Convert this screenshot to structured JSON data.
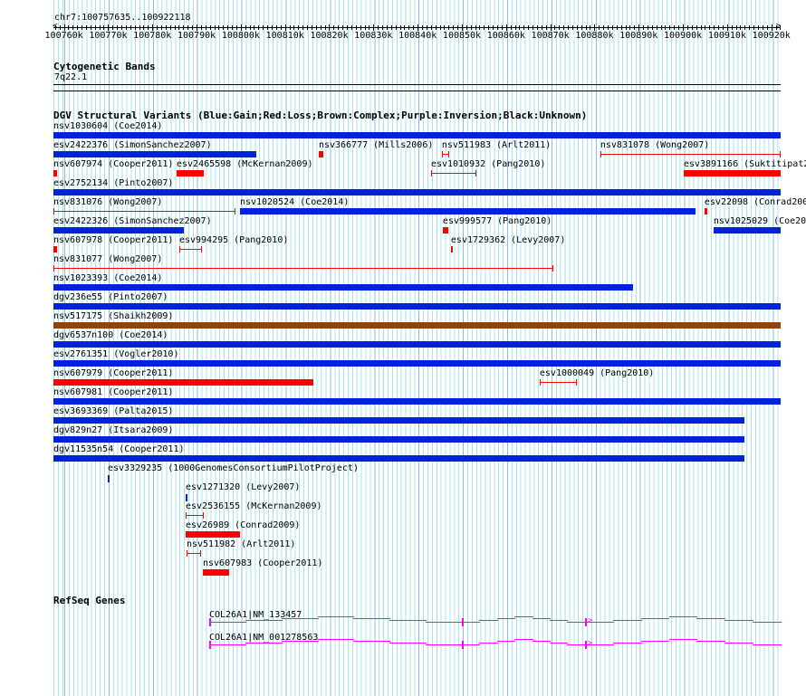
{
  "ruler": {
    "location": "chr7:100757635..100922118",
    "view_start": 100757635,
    "view_end": 100922118,
    "ticks": [
      "100760k",
      "100770k",
      "100780k",
      "100790k",
      "100800k",
      "100810k",
      "100820k",
      "100830k",
      "100840k",
      "100850k",
      "100860k",
      "100870k",
      "100880k",
      "100890k",
      "100900k",
      "100910k",
      "100920k"
    ]
  },
  "cyto": {
    "title": "Cytogenetic Bands",
    "band": "7q22.1"
  },
  "dgv": {
    "title": "DGV Structural Variants (Blue:Gain;Red:Loss;Brown:Complex;Purple:Inversion;Black:Unknown)",
    "colors": {
      "gain": "#0022dd",
      "loss": "#ff0000",
      "complex": "#8b4513"
    },
    "rows": [
      [
        {
          "label": "nsv1030604 (Coe2014)",
          "s": 100757635,
          "e": 100922118,
          "t": "gain"
        }
      ],
      [
        {
          "label": "esv2422376 (SimonSanchez2007)",
          "s": 100757635,
          "e": 100803510,
          "t": "gain"
        },
        {
          "label": "nsv366777 (Mills2006)",
          "s": 100817640,
          "e": 100818670,
          "t": "loss"
        },
        {
          "label": "nsv511983 (Arlt2011)",
          "s": 100845490,
          "e": 100847130,
          "t": "loss",
          "thin": true
        },
        {
          "label": "nsv831078 (Wong2007)",
          "s": 100881330,
          "e": 100922118,
          "t": "loss",
          "thin": true
        }
      ],
      [
        {
          "label": "nsv607974 (Cooper2011)",
          "s": 100757635,
          "e": 100758450,
          "t": "loss"
        },
        {
          "label": "esv2465598 (McKernan2009)",
          "s": 100785490,
          "e": 100791630,
          "t": "loss"
        },
        {
          "label": "esv1010932 (Pang2010)",
          "s": 100843040,
          "e": 100853280,
          "t": "loss",
          "thin": true
        },
        {
          "label": "esv3891166 (Suktitipat2014)",
          "s": 100900180,
          "e": 100922118,
          "t": "loss"
        }
      ],
      [
        {
          "label": "esv2752134 (Pinto2007)",
          "s": 100757635,
          "e": 100922118,
          "t": "gain"
        }
      ],
      [
        {
          "label": "nsv831076 (Wong2007)",
          "s": 100757635,
          "e": 100798800,
          "t": "loss",
          "thin": true
        },
        {
          "label": "nsv1020524 (Coe2014)",
          "s": 100799820,
          "e": 100902840,
          "t": "gain"
        },
        {
          "label": "esv22098 (Conrad2009)",
          "s": 100904890,
          "e": 100905500,
          "t": "loss"
        }
      ],
      [
        {
          "label": "esv2422326 (SimonSanchez2007)",
          "s": 100757635,
          "e": 100787130,
          "t": "gain"
        },
        {
          "label": "esv999577 (Pang2010)",
          "s": 100845700,
          "e": 100846930,
          "t": "loss"
        },
        {
          "label": "nsv1025029 (Coe2014)",
          "s": 100906930,
          "e": 100922118,
          "t": "gain"
        }
      ],
      [
        {
          "label": "nsv607978 (Cooper2011)",
          "s": 100757635,
          "e": 100758450,
          "t": "loss"
        },
        {
          "label": "esv994295 (Pang2010)",
          "s": 100786100,
          "e": 100791220,
          "t": "loss",
          "thin": true
        },
        {
          "label": "esv1729362 (Levy2007)",
          "s": 100847540,
          "e": 100847950,
          "t": "loss"
        }
      ],
      [
        {
          "label": "nsv831077 (Wong2007)",
          "s": 100757635,
          "e": 100870690,
          "t": "loss",
          "thin": true
        }
      ],
      [
        {
          "label": "nsv1023393 (Coe2014)",
          "s": 100757635,
          "e": 100888710,
          "t": "gain"
        }
      ],
      [
        {
          "label": "dgv236e55 (Pinto2007)",
          "s": 100757635,
          "e": 100922118,
          "t": "gain"
        }
      ],
      [
        {
          "label": "nsv517175 (Shaikh2009)",
          "s": 100757635,
          "e": 100922118,
          "t": "complex"
        }
      ],
      [
        {
          "label": "dgv6537n100 (Coe2014)",
          "s": 100757635,
          "e": 100922118,
          "t": "gain"
        }
      ],
      [
        {
          "label": "esv2761351 (Vogler2010)",
          "s": 100757635,
          "e": 100922118,
          "t": "gain"
        }
      ],
      [
        {
          "label": "nsv607979 (Cooper2011)",
          "s": 100757635,
          "e": 100816410,
          "t": "loss"
        },
        {
          "label": "esv1000049 (Pang2010)",
          "s": 100867610,
          "e": 100876010,
          "t": "loss",
          "thin": true
        }
      ],
      [
        {
          "label": "nsv607981 (Cooper2011)",
          "s": 100757635,
          "e": 100922118,
          "t": "gain"
        }
      ],
      [
        {
          "label": "esv3693369 (Palta2015)",
          "s": 100757635,
          "e": 100913900,
          "t": "gain"
        }
      ],
      [
        {
          "label": "dgv829n27 (Itsara2009)",
          "s": 100757635,
          "e": 100913900,
          "t": "gain"
        }
      ],
      [
        {
          "label": "dgv11535n54 (Cooper2011)",
          "s": 100757635,
          "e": 100913900,
          "t": "gain"
        }
      ],
      [
        {
          "label": "esv3329235 (1000GenomesConsortiumPilotProject)",
          "s": 100769920,
          "e": 100770330,
          "t": "gain",
          "narrow": true
        }
      ],
      [
        {
          "label": "esv1271320 (Levy2007)",
          "s": 100787540,
          "e": 100787950,
          "t": "gain",
          "narrow": true
        }
      ],
      [
        {
          "label": "esv2536155 (McKernan2009)",
          "s": 100787540,
          "e": 100791630,
          "t": "loss",
          "thin": true
        }
      ],
      [
        {
          "label": "esv26989 (Conrad2009)",
          "s": 100787540,
          "e": 100799820,
          "t": "loss"
        }
      ],
      [
        {
          "label": "nsv511982 (Arlt2011)",
          "s": 100787740,
          "e": 100791020,
          "t": "loss",
          "thin": true
        }
      ],
      [
        {
          "label": "nsv607983 (Cooper2011)",
          "s": 100791430,
          "e": 100797370,
          "t": "loss"
        }
      ]
    ]
  },
  "refseq": {
    "title": "RefSeq Genes",
    "color": "#ff00ff",
    "strand": "+",
    "genes": [
      {
        "label": "COL26A1|NM_133457",
        "s": 100792860,
        "exons": [
          100792860,
          100850000,
          100877850
        ]
      },
      {
        "label": "COL26A1|NM_001278563",
        "s": 100792860,
        "exons": [
          100792860,
          100850000,
          100877850
        ]
      }
    ]
  }
}
